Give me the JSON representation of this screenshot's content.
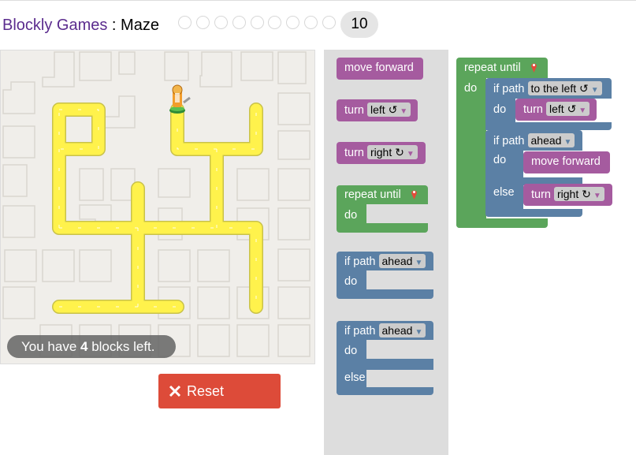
{
  "header": {
    "app": "Blockly Games",
    "sep": " : ",
    "game": "Maze",
    "current_level": "10",
    "levels": [
      "1",
      "2",
      "3",
      "4",
      "5",
      "6",
      "7",
      "8",
      "9",
      "10"
    ]
  },
  "status": {
    "prefix": "You have ",
    "count": "4",
    "suffix": " blocks left."
  },
  "reset": {
    "label": "Reset"
  },
  "toolbox": {
    "move_forward": "move forward",
    "turn_label": "turn",
    "turn_left_value": "left ↺",
    "turn_right_value": "right ↻",
    "repeat_until": "repeat until",
    "do": "do",
    "else": "else",
    "if_path": "if path",
    "ahead_value": "ahead"
  },
  "workspace": {
    "repeat_until": "repeat until",
    "do": "do",
    "else": "else",
    "if_path": "if path",
    "to_the_left": "to the left ↺",
    "ahead": "ahead",
    "turn": "turn",
    "left": "left ↺",
    "right": "right ↻",
    "move_forward": "move forward"
  },
  "colors": {
    "motion": "#a55b9f",
    "loop": "#5ba55b",
    "logic": "#5b80a5",
    "reset": "#dd4b39",
    "path": "#fff24c",
    "title": "#5b2c8e"
  }
}
